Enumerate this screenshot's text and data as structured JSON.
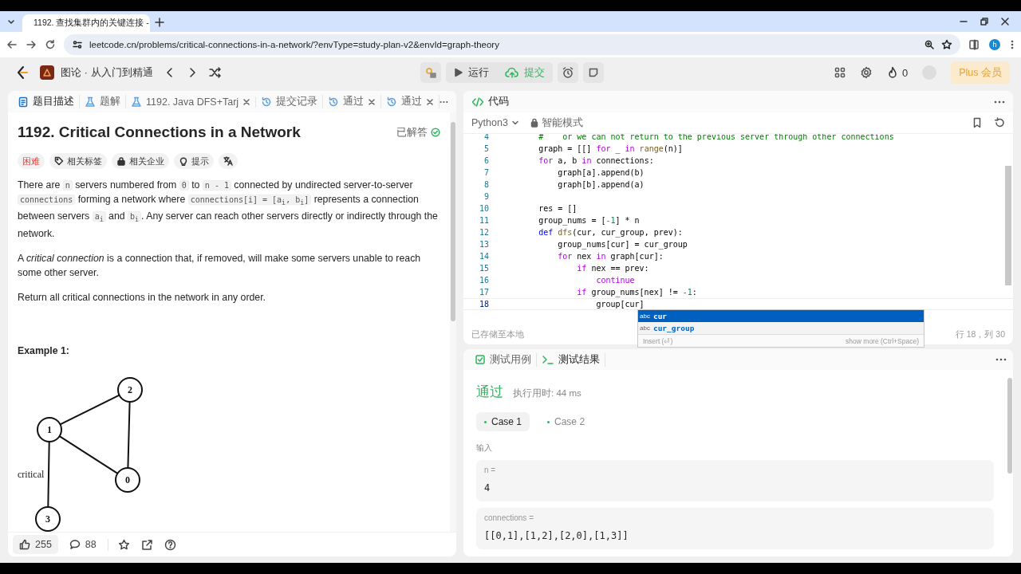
{
  "browser": {
    "tab_title": "1192. 查找集群内的关键连接 -",
    "url": "leetcode.cn/problems/critical-connections-in-a-network/?envType=study-plan-v2&envId=graph-theory",
    "profile_initial": "h"
  },
  "toolbar": {
    "study_plan": "图论 · 从入门到精通",
    "run": "运行",
    "submit": "提交",
    "streak": "0",
    "plus": "Plus 会员"
  },
  "description": {
    "tabs": [
      {
        "label": "题目描述",
        "kind": "description",
        "closable": false,
        "selected": true
      },
      {
        "label": "题解",
        "kind": "solution",
        "closable": false,
        "selected": false
      },
      {
        "label": "1192. Java DFS+Tarj",
        "kind": "solution",
        "closable": true,
        "selected": false
      },
      {
        "label": "提交记录",
        "kind": "submission",
        "closable": false,
        "selected": false
      },
      {
        "label": "通过",
        "kind": "submission",
        "closable": true,
        "selected": false
      },
      {
        "label": "通过",
        "kind": "submission",
        "closable": true,
        "selected": false
      }
    ],
    "title": "1192. Critical Connections in a Network",
    "status": "已解答",
    "tags": [
      {
        "kind": "difficulty",
        "label": "困难"
      },
      {
        "kind": "tag",
        "label": "相关标签"
      },
      {
        "kind": "company",
        "label": "相关企业"
      },
      {
        "kind": "hint",
        "label": "提示"
      },
      {
        "kind": "translate"
      }
    ],
    "paragraphs": [
      [
        {
          "kind": "text",
          "text": "There are "
        },
        {
          "kind": "code",
          "text": "n"
        },
        {
          "kind": "text",
          "text": " servers numbered from "
        },
        {
          "kind": "code",
          "text": "0"
        },
        {
          "kind": "text",
          "text": " to "
        },
        {
          "kind": "code",
          "text": "n - 1"
        },
        {
          "kind": "text",
          "text": " connected by undirected server-to-server "
        },
        {
          "kind": "code",
          "text": "connections"
        },
        {
          "kind": "text",
          "text": " forming a network where "
        },
        {
          "kind": "code",
          "text": "connections[i] = [a$_{i}$, b$_{i}$]"
        },
        {
          "kind": "text",
          "text": " represents a connection between servers "
        },
        {
          "kind": "code",
          "text": "a$_{i}$"
        },
        {
          "kind": "text",
          "text": " and "
        },
        {
          "kind": "code",
          "text": "b$_{i}$"
        },
        {
          "kind": "text",
          "text": ". Any server can reach other servers directly or indirectly through the network."
        }
      ],
      [
        {
          "kind": "text",
          "text": "A *critical connection* is a connection that, if removed, will make some servers unable to reach some other server."
        }
      ],
      [
        {
          "kind": "text",
          "text": "Return all critical connections in the network in any order."
        }
      ]
    ],
    "example_heading": "Example 1:",
    "graph": {
      "nodes": [
        "0",
        "1",
        "2",
        "3"
      ],
      "critical_label": "critical"
    },
    "likes": "255",
    "comments": "88"
  },
  "editor": {
    "title": "代码",
    "language": "Python3",
    "mode": "智能模式",
    "lines": [
      {
        "number": "4",
        "current": false,
        "tokens": [
          {
            "kind": "comment",
            "text": "        #    or we can not return to the previous server through other connections"
          }
        ]
      },
      {
        "number": "5",
        "current": false,
        "tokens": [
          {
            "kind": "plain",
            "text": "        graph = [[] "
          },
          {
            "kind": "keyword",
            "text": "for"
          },
          {
            "kind": "plain",
            "text": " _ "
          },
          {
            "kind": "keyword",
            "text": "in"
          },
          {
            "kind": "function",
            "text": " range"
          },
          {
            "kind": "plain",
            "text": "(n)]"
          }
        ]
      },
      {
        "number": "6",
        "current": false,
        "tokens": [
          {
            "kind": "keyword",
            "text": "        for"
          },
          {
            "kind": "plain",
            "text": " a, b "
          },
          {
            "kind": "keyword",
            "text": "in"
          },
          {
            "kind": "plain",
            "text": " connections:"
          }
        ]
      },
      {
        "number": "7",
        "current": false,
        "tokens": [
          {
            "kind": "plain",
            "text": "            graph[a].append(b)"
          }
        ]
      },
      {
        "number": "8",
        "current": false,
        "tokens": [
          {
            "kind": "plain",
            "text": "            graph[b].append(a)"
          }
        ]
      },
      {
        "number": "9",
        "current": false
      },
      {
        "number": "10",
        "current": false,
        "tokens": [
          {
            "kind": "plain",
            "text": "        res = []"
          }
        ]
      },
      {
        "number": "11",
        "current": false,
        "tokens": [
          {
            "kind": "plain",
            "text": "        group_nums = ["
          },
          {
            "kind": "number",
            "text": "-1"
          },
          {
            "kind": "plain",
            "text": "] * n"
          }
        ]
      },
      {
        "number": "12",
        "current": false,
        "tokens": [
          {
            "kind": "def",
            "text": "        def"
          },
          {
            "kind": "function",
            "text": " dfs"
          },
          {
            "kind": "plain",
            "text": "(cur, cur_group, prev):"
          }
        ]
      },
      {
        "number": "13",
        "current": false,
        "tokens": [
          {
            "kind": "plain",
            "text": "            group_nums[cur] = cur_group"
          }
        ]
      },
      {
        "number": "14",
        "current": false,
        "tokens": [
          {
            "kind": "keyword",
            "text": "            for"
          },
          {
            "kind": "plain",
            "text": " nex "
          },
          {
            "kind": "keyword",
            "text": "in"
          },
          {
            "kind": "plain",
            "text": " graph[cur]:"
          }
        ]
      },
      {
        "number": "15",
        "current": false,
        "tokens": [
          {
            "kind": "keyword",
            "text": "                if"
          },
          {
            "kind": "plain",
            "text": " nex == prev:"
          }
        ]
      },
      {
        "number": "16",
        "current": false,
        "tokens": [
          {
            "kind": "keyword",
            "text": "                    continue"
          }
        ]
      },
      {
        "number": "17",
        "current": false,
        "tokens": [
          {
            "kind": "keyword",
            "text": "                if"
          },
          {
            "kind": "plain",
            "text": " group_nums[nex] != "
          },
          {
            "kind": "number",
            "text": "-1"
          },
          {
            "kind": "plain",
            "text": ":"
          }
        ]
      },
      {
        "number": "18",
        "current": true,
        "tokens": [
          {
            "kind": "plain",
            "text": "                    group[cur]"
          }
        ]
      }
    ],
    "suggestions": [
      {
        "type": "abc",
        "label": "cur",
        "selected": true
      },
      {
        "type": "abc",
        "label": "cur_group",
        "selected": false
      }
    ],
    "suggest_insert": "Insert (⏎)",
    "suggest_more": "show more (Ctrl+Space)",
    "saved": "已存储至本地",
    "position": "行 18，列 30"
  },
  "tests": {
    "tabs": [
      {
        "label": "测试用例",
        "kind": "testcase",
        "selected": false
      },
      {
        "label": "测试结果",
        "kind": "result",
        "selected": true
      }
    ],
    "verdict": "通过",
    "runtime": "执行用时: 44 ms",
    "cases": [
      {
        "label": "Case 1",
        "selected": true
      },
      {
        "label": "Case 2",
        "selected": false
      }
    ],
    "input_label": "输入",
    "inputs": [
      {
        "name": "n =",
        "value": "4"
      },
      {
        "name": "connections =",
        "value": "[[0,1],[1,2],[2,0],[1,3]]"
      }
    ]
  }
}
